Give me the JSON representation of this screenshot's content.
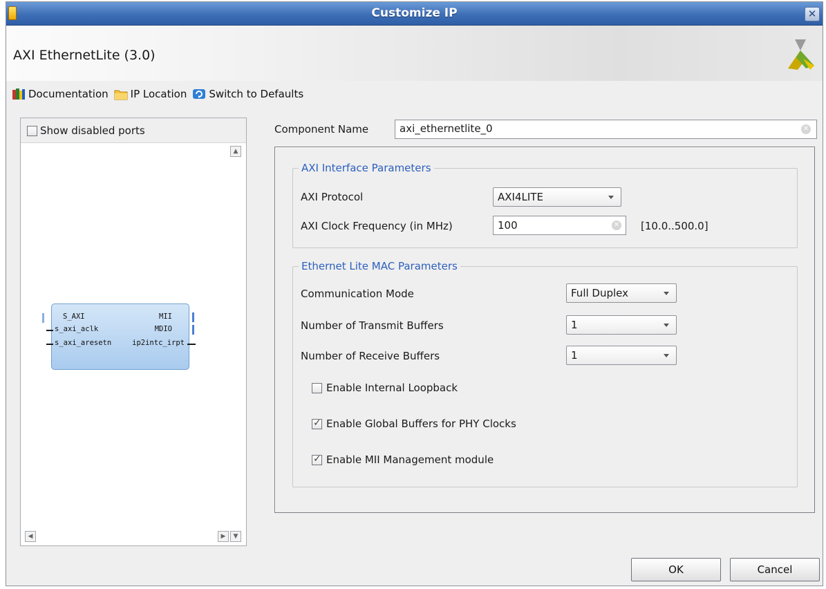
{
  "window": {
    "title": "Customize IP",
    "close_glyph": "✕"
  },
  "banner": {
    "ip_title": "AXI EthernetLite (3.0)",
    "logo_icon": "xilinx-logo"
  },
  "toolbar": {
    "items": [
      {
        "label": "Documentation",
        "icon": "books-icon"
      },
      {
        "label": "IP Location",
        "icon": "folder-icon"
      },
      {
        "label": "Switch to Defaults",
        "icon": "refresh-icon"
      }
    ]
  },
  "ports_panel": {
    "show_disabled_label": "Show disabled ports",
    "show_disabled_checked": false,
    "block": {
      "left_ports": [
        "S_AXI",
        "s_axi_aclk",
        "s_axi_aresetn"
      ],
      "right_ports": [
        "MII",
        "MDIO",
        "ip2intc_irpt"
      ]
    }
  },
  "component": {
    "label": "Component Name",
    "value": "axi_ethernetlite_0"
  },
  "axi_group": {
    "legend": "AXI Interface Parameters",
    "protocol_label": "AXI Protocol",
    "protocol_value": "AXI4LITE",
    "clock_label": "AXI Clock Frequency (in MHz)",
    "clock_value": "100",
    "clock_range": "[10.0..500.0]"
  },
  "mac_group": {
    "legend": "Ethernet Lite MAC Parameters",
    "comm_mode_label": "Communication Mode",
    "comm_mode_value": "Full Duplex",
    "tx_buffers_label": "Number of Transmit Buffers",
    "tx_buffers_value": "1",
    "rx_buffers_label": "Number of Receive Buffers",
    "rx_buffers_value": "1",
    "loopback_label": "Enable Internal Loopback",
    "loopback_checked": false,
    "global_buffers_label": "Enable Global Buffers for PHY Clocks",
    "global_buffers_checked": true,
    "mii_mgmt_label": "Enable MII Management module",
    "mii_mgmt_checked": true
  },
  "footer": {
    "ok_label": "OK",
    "cancel_label": "Cancel"
  },
  "colors": {
    "titlebar": "#3e6fb6",
    "legend_text": "#2c5fbd",
    "ip_block_fill": "#a9cbee"
  }
}
